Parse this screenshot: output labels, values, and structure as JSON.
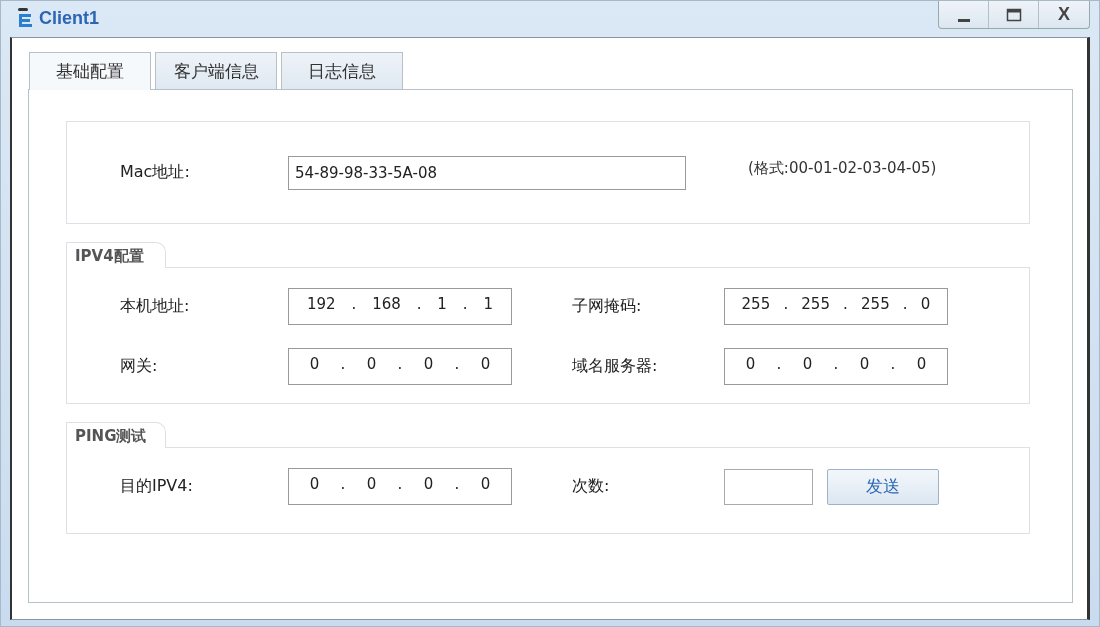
{
  "window": {
    "title": "Client1",
    "controls": [
      {
        "kind": "minimize"
      },
      {
        "kind": "maximize"
      },
      {
        "kind": "close",
        "label": "X"
      }
    ]
  },
  "tabs": [
    {
      "label": "基础配置",
      "selected": true
    },
    {
      "label": "客户端信息",
      "selected": false
    },
    {
      "label": "日志信息",
      "selected": false
    }
  ],
  "mac": {
    "label": "Mac地址:",
    "value": "54-89-98-33-5A-08",
    "hint": "(格式:00-01-02-03-04-05)"
  },
  "ipv4": {
    "title": "IPV4配置",
    "fields": [
      {
        "label": "本机地址:",
        "segments": [
          "192",
          ".",
          "168",
          ".",
          "1",
          ".",
          "1"
        ]
      },
      {
        "label": "子网掩码:",
        "segments": [
          "255",
          ".",
          "255",
          ".",
          "255",
          ".",
          "0"
        ]
      },
      {
        "label": "网关:",
        "segments": [
          "0",
          ".",
          "0",
          ".",
          "0",
          ".",
          "0"
        ]
      },
      {
        "label": "域名服务器:",
        "segments": [
          "0",
          ".",
          "0",
          ".",
          "0",
          ".",
          "0"
        ]
      }
    ]
  },
  "ping": {
    "title": "PING测试",
    "target_label": "目的IPV4:",
    "target_segments": [
      "0",
      ".",
      "0",
      ".",
      "0",
      ".",
      "0"
    ],
    "count_label": "次数:",
    "send_button": "发送"
  }
}
